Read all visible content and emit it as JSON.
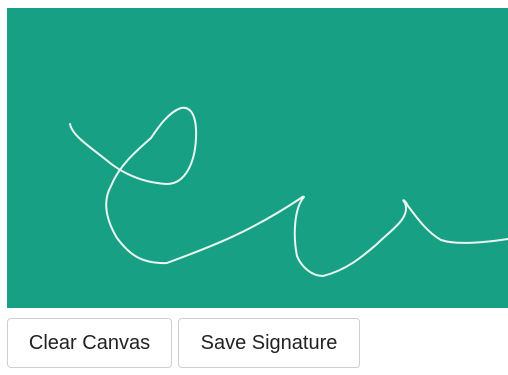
{
  "canvas": {
    "background_color": "#18a085",
    "stroke_color": "#e8f6f1"
  },
  "actions": {
    "clear_label": "Clear Canvas",
    "save_label": "Save Signature"
  }
}
